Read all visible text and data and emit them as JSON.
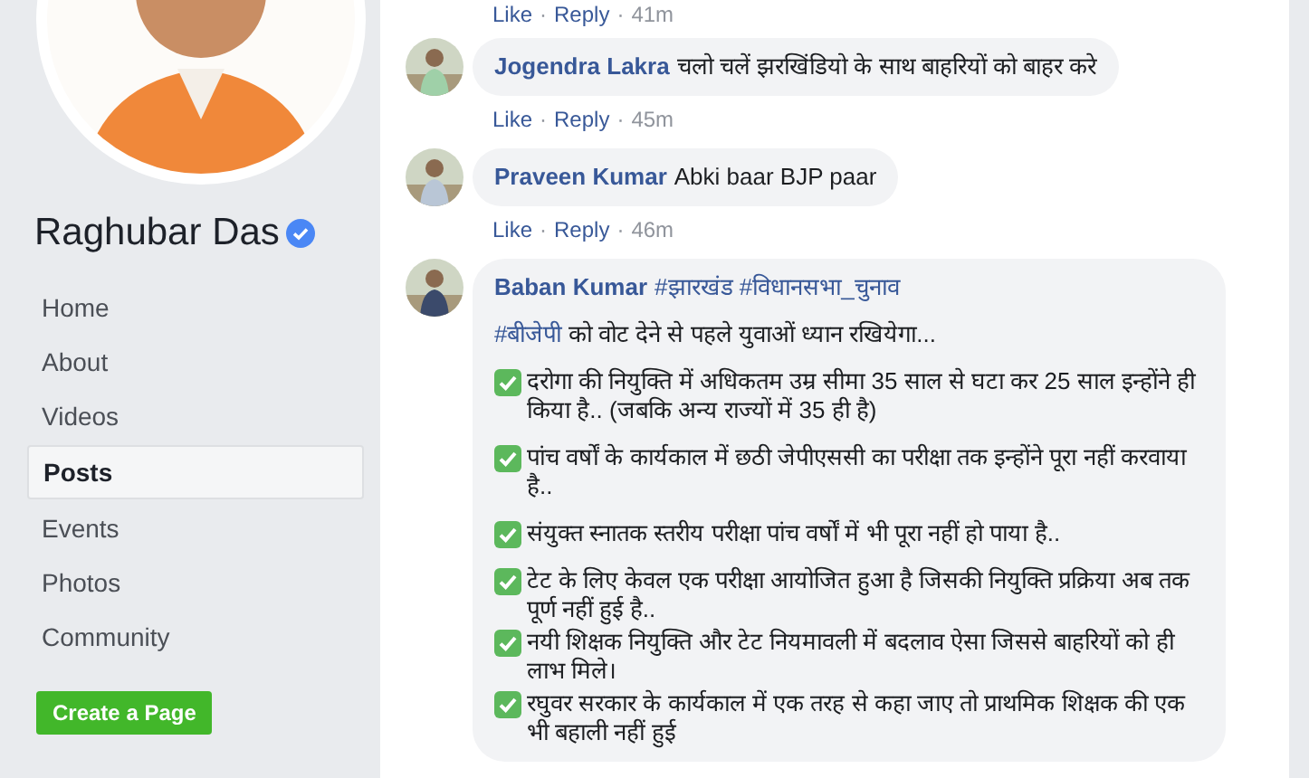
{
  "page": {
    "name": "Raghubar Das",
    "verified": true
  },
  "nav": [
    {
      "label": "Home",
      "selected": false
    },
    {
      "label": "About",
      "selected": false
    },
    {
      "label": "Videos",
      "selected": false
    },
    {
      "label": "Posts",
      "selected": true
    },
    {
      "label": "Events",
      "selected": false
    },
    {
      "label": "Photos",
      "selected": false
    },
    {
      "label": "Community",
      "selected": false
    }
  ],
  "create_button": "Create a Page",
  "previous_meta": {
    "like": "Like",
    "sep": "·",
    "reply": "Reply",
    "time": "41m"
  },
  "comments": [
    {
      "author": "Jogendra Lakra",
      "text": "चलो चलें झरखिंडियो के साथ बाहरियों को बाहर करे",
      "meta": {
        "like": "Like",
        "sep": "·",
        "reply": "Reply",
        "time": "45m"
      }
    },
    {
      "author": "Praveen Kumar",
      "text": "Abki baar BJP paar",
      "meta": {
        "like": "Like",
        "sep": "·",
        "reply": "Reply",
        "time": "46m"
      }
    }
  ],
  "long_comment": {
    "author": "Baban Kumar",
    "hashtags": "#झारखंड #विधानसभा_चुनाव",
    "paragraphs": [
      {
        "kind": "tagged",
        "tag": "#बीजेपी",
        "text": "को वोट देने से पहले युवाओं ध्यान रखियेगा..."
      },
      {
        "kind": "check",
        "text": "दरोगा की नियुक्ति में अधिकतम उम्र सीमा 35 साल से घटा कर 25 साल इन्होंने ही किया है.. (जबकि अन्य राज्यों में 35 ही है)"
      },
      {
        "kind": "check",
        "text": "पांच वर्षों के कार्यकाल में छठी जेपीएससी का परीक्षा तक इन्होंने पूरा नहीं करवाया है.."
      },
      {
        "kind": "check",
        "text": "संयुक्त स्नातक स्तरीय परीक्षा पांच वर्षों में भी पूरा नहीं हो पाया है.."
      },
      {
        "kind": "check",
        "text": "टेट के लिए केवल एक परीक्षा आयोजित हुआ है जिसकी नियुक्ति प्रक्रिया अब तक पूर्ण नहीं हुई है.."
      },
      {
        "kind": "check",
        "text": "नयी शिक्षक नियुक्ति और टेट नियमावली में बदलाव ऐसा जिससे बाहरियों को ही लाभ मिले।"
      },
      {
        "kind": "check",
        "text": "रघुवर सरकार के कार्यकाल में एक तरह से कहा जाए तो प्राथमिक शिक्षक की एक भी बहाली नहीं हुई"
      }
    ]
  }
}
